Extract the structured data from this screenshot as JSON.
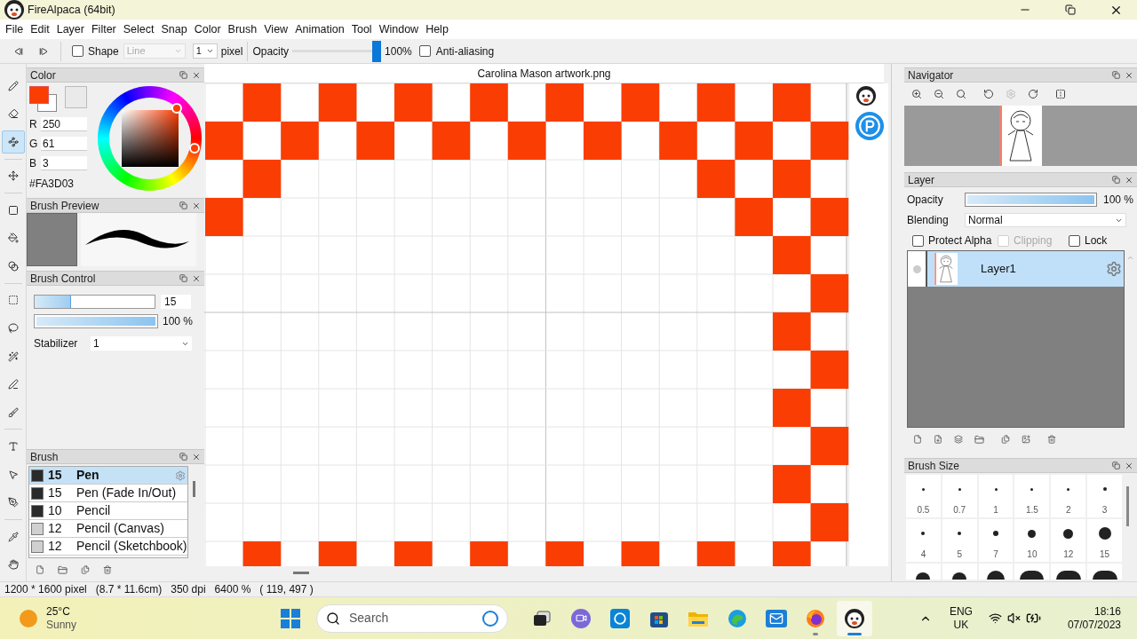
{
  "window": {
    "title": "FireAlpaca (64bit)"
  },
  "menu": [
    "File",
    "Edit",
    "Layer",
    "Filter",
    "Select",
    "Snap",
    "Color",
    "Brush",
    "View",
    "Animation",
    "Tool",
    "Window",
    "Help"
  ],
  "toolbar": {
    "shape": {
      "label": "Shape",
      "checked": false,
      "value": "Line"
    },
    "size": {
      "value": "1",
      "unit": "pixel"
    },
    "opacity": {
      "label": "Opacity",
      "level": 1,
      "value": "100%"
    },
    "antialiasing": {
      "label": "Anti-aliasing",
      "checked": false
    }
  },
  "tools": [
    {
      "kind": "pen",
      "selected": false
    },
    {
      "kind": "eraser",
      "selected": false
    },
    {
      "kind": "dot",
      "selected": true
    },
    {
      "kind": "move",
      "selected": false
    },
    {
      "kind": "fill",
      "selected": false
    },
    {
      "kind": "bucket",
      "selected": false
    },
    {
      "kind": "gradient",
      "selected": false
    },
    {
      "kind": "select",
      "selected": false
    },
    {
      "kind": "lasso",
      "selected": false
    },
    {
      "kind": "wand",
      "selected": false
    },
    {
      "kind": "select-pen",
      "selected": false
    },
    {
      "kind": "select-eraser",
      "selected": false
    },
    {
      "kind": "text",
      "selected": false
    },
    {
      "kind": "operation",
      "selected": false
    },
    {
      "kind": "divide",
      "selected": false
    },
    {
      "kind": "eyedropper",
      "selected": false
    },
    {
      "kind": "hand",
      "selected": false
    }
  ],
  "color_panel": {
    "title": "Color",
    "channels": [
      {
        "label": "R",
        "value": "250"
      },
      {
        "label": "G",
        "value": "61"
      },
      {
        "label": "B",
        "value": "3"
      }
    ],
    "hex": "#FA3D03"
  },
  "brush_preview": {
    "title": "Brush Preview"
  },
  "brush_control": {
    "title": "Brush Control",
    "size": {
      "level": 0.3,
      "value": "15"
    },
    "opacity": {
      "level": 1,
      "value": "100 %"
    },
    "stabilizer": {
      "label": "Stabilizer",
      "value": "1"
    }
  },
  "brush_panel": {
    "title": "Brush",
    "brushes": [
      {
        "kind": "dark",
        "size": "15",
        "name": "Pen",
        "selected": true
      },
      {
        "kind": "dark",
        "size": "15",
        "name": "Pen (Fade In/Out)",
        "selected": false
      },
      {
        "kind": "dark",
        "size": "10",
        "name": "Pencil",
        "selected": false
      },
      {
        "kind": "light",
        "size": "12",
        "name": "Pencil (Canvas)",
        "selected": false
      },
      {
        "kind": "light",
        "size": "12",
        "name": "Pencil (Sketchbook)",
        "selected": false
      }
    ]
  },
  "document": {
    "title": "Carolina Mason artwork.png"
  },
  "navigator": {
    "title": "Navigator"
  },
  "layer_panel": {
    "title": "Layer",
    "opacity": {
      "label": "Opacity",
      "level": 1,
      "value": "100 %"
    },
    "blending": {
      "label": "Blending",
      "value": "Normal"
    },
    "options": [
      {
        "label": "Protect Alpha",
        "checked": false,
        "disabled": false
      },
      {
        "label": "Clipping",
        "checked": false,
        "disabled": true
      },
      {
        "label": "Lock",
        "checked": false,
        "disabled": false
      }
    ],
    "layers": [
      {
        "name": "Layer1",
        "selected": true
      }
    ]
  },
  "brush_size": {
    "title": "Brush Size",
    "sizes": [
      "0.5",
      "0.7",
      "1",
      "1.5",
      "2",
      "3",
      "4",
      "5",
      "7",
      "10",
      "12",
      "15"
    ]
  },
  "status_bar": [
    "1200 * 1600 pixel",
    "(8.7 * 11.6cm)",
    "350 dpi",
    "6400 %",
    "( 119, 497 )"
  ],
  "taskbar": {
    "weather": {
      "temperature": "25°C",
      "condition": "Sunny"
    },
    "search": {
      "placeholder": "Search"
    },
    "apps": [
      {
        "kind": "taskview",
        "running": false,
        "selected": false
      },
      {
        "kind": "teams",
        "running": false,
        "selected": false
      },
      {
        "kind": "cortana",
        "running": false,
        "selected": false
      },
      {
        "kind": "store",
        "running": false,
        "selected": false
      },
      {
        "kind": "explorer",
        "running": false,
        "selected": false
      },
      {
        "kind": "edge",
        "running": false,
        "selected": false
      },
      {
        "kind": "mail",
        "running": false,
        "selected": false
      },
      {
        "kind": "firefox",
        "running": true,
        "selected": false
      },
      {
        "kind": "firealpaca",
        "running": true,
        "selected": true
      }
    ],
    "language": [
      "ENG",
      "UK"
    ],
    "time": "18:16",
    "date": "07/07/2023"
  }
}
